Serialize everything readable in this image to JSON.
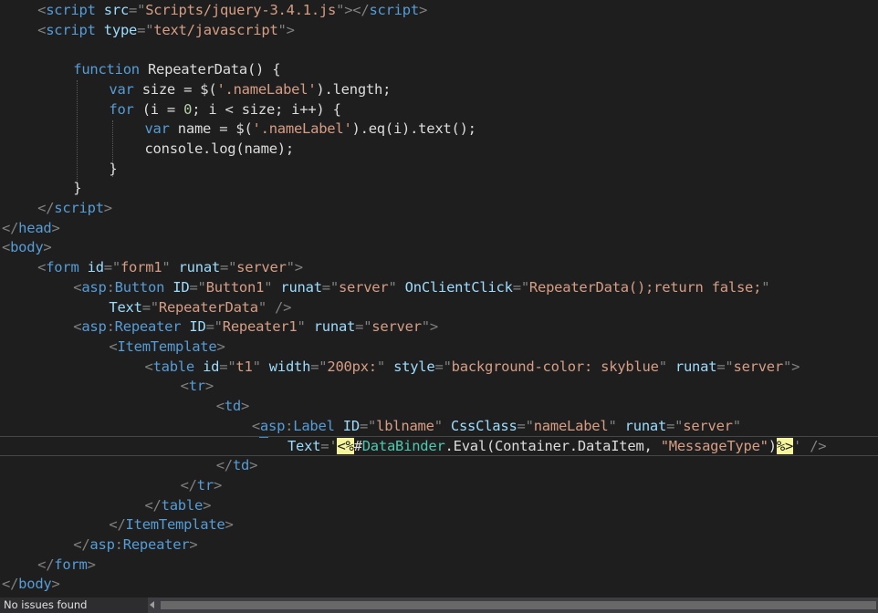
{
  "editor": {
    "lines": [
      {
        "indent": 4,
        "tokens": [
          [
            "p",
            "<"
          ],
          [
            "tag",
            "script"
          ],
          [
            "txt",
            " "
          ],
          [
            "attr",
            "src"
          ],
          [
            "p",
            "=\""
          ],
          [
            "str",
            "Scripts/jquery-3.4.1.js"
          ],
          [
            "p",
            "\"></"
          ],
          [
            "tag",
            "script"
          ],
          [
            "p",
            ">"
          ]
        ]
      },
      {
        "indent": 4,
        "tokens": [
          [
            "p",
            "<"
          ],
          [
            "tag",
            "script"
          ],
          [
            "txt",
            " "
          ],
          [
            "attr",
            "type"
          ],
          [
            "p",
            "=\""
          ],
          [
            "str",
            "text/javascript"
          ],
          [
            "p",
            "\">"
          ]
        ]
      },
      {
        "indent": 0,
        "tokens": []
      },
      {
        "indent": 8,
        "tokens": [
          [
            "kw",
            "function"
          ],
          [
            "txt",
            " RepeaterData() {"
          ]
        ]
      },
      {
        "indent": 12,
        "tokens": [
          [
            "kw",
            "var"
          ],
          [
            "txt",
            " size = $("
          ],
          [
            "js",
            "'.nameLabel'"
          ],
          [
            "txt",
            ").length;"
          ]
        ]
      },
      {
        "indent": 12,
        "tokens": [
          [
            "kw",
            "for"
          ],
          [
            "txt",
            " (i = "
          ],
          [
            "num",
            "0"
          ],
          [
            "txt",
            "; i < size; i++) {"
          ]
        ]
      },
      {
        "indent": 16,
        "tokens": [
          [
            "kw",
            "var"
          ],
          [
            "txt",
            " name = $("
          ],
          [
            "js",
            "'.nameLabel'"
          ],
          [
            "txt",
            ").eq(i).text();"
          ]
        ]
      },
      {
        "indent": 16,
        "tokens": [
          [
            "txt",
            "console.log(name);"
          ]
        ]
      },
      {
        "indent": 12,
        "tokens": [
          [
            "txt",
            "}"
          ]
        ]
      },
      {
        "indent": 8,
        "tokens": [
          [
            "txt",
            "}"
          ]
        ]
      },
      {
        "indent": 4,
        "tokens": [
          [
            "p",
            "</"
          ],
          [
            "tag",
            "script"
          ],
          [
            "p",
            ">"
          ]
        ]
      },
      {
        "indent": 0,
        "tokens": [
          [
            "p",
            "</"
          ],
          [
            "tag",
            "head"
          ],
          [
            "p",
            ">"
          ]
        ]
      },
      {
        "indent": 0,
        "tokens": [
          [
            "p",
            "<"
          ],
          [
            "tag",
            "body"
          ],
          [
            "p",
            ">"
          ]
        ]
      },
      {
        "indent": 4,
        "tokens": [
          [
            "p",
            "<"
          ],
          [
            "tag",
            "form"
          ],
          [
            "txt",
            " "
          ],
          [
            "attr",
            "id"
          ],
          [
            "p",
            "=\""
          ],
          [
            "str",
            "form1"
          ],
          [
            "p",
            "\""
          ],
          [
            "txt",
            " "
          ],
          [
            "attr",
            "runat"
          ],
          [
            "p",
            "=\""
          ],
          [
            "str",
            "server"
          ],
          [
            "p",
            "\">"
          ]
        ]
      },
      {
        "indent": 8,
        "tokens": [
          [
            "p",
            "<"
          ],
          [
            "tag",
            "asp"
          ],
          [
            "p",
            ":"
          ],
          [
            "tag",
            "Button"
          ],
          [
            "txt",
            " "
          ],
          [
            "attr",
            "ID"
          ],
          [
            "p",
            "=\""
          ],
          [
            "str",
            "Button1"
          ],
          [
            "p",
            "\""
          ],
          [
            "txt",
            " "
          ],
          [
            "attr",
            "runat"
          ],
          [
            "p",
            "=\""
          ],
          [
            "str",
            "server"
          ],
          [
            "p",
            "\""
          ],
          [
            "txt",
            " "
          ],
          [
            "attr",
            "OnClientClick"
          ],
          [
            "p",
            "=\""
          ],
          [
            "str",
            "RepeaterData();return false;"
          ],
          [
            "p",
            "\""
          ]
        ]
      },
      {
        "indent": 12,
        "tokens": [
          [
            "attr",
            "Text"
          ],
          [
            "p",
            "=\""
          ],
          [
            "str",
            "RepeaterData"
          ],
          [
            "p",
            "\""
          ],
          [
            "txt",
            " "
          ],
          [
            "p",
            "/>"
          ]
        ]
      },
      {
        "indent": 8,
        "tokens": [
          [
            "p",
            "<"
          ],
          [
            "tag",
            "asp"
          ],
          [
            "p",
            ":"
          ],
          [
            "tag",
            "Repeater"
          ],
          [
            "txt",
            " "
          ],
          [
            "attr",
            "ID"
          ],
          [
            "p",
            "=\""
          ],
          [
            "str",
            "Repeater1"
          ],
          [
            "p",
            "\""
          ],
          [
            "txt",
            " "
          ],
          [
            "attr",
            "runat"
          ],
          [
            "p",
            "=\""
          ],
          [
            "str",
            "server"
          ],
          [
            "p",
            "\">"
          ]
        ]
      },
      {
        "indent": 12,
        "tokens": [
          [
            "p",
            "<"
          ],
          [
            "tag",
            "ItemTemplate"
          ],
          [
            "p",
            ">"
          ]
        ]
      },
      {
        "indent": 16,
        "tokens": [
          [
            "p",
            "<"
          ],
          [
            "tag",
            "table"
          ],
          [
            "txt",
            " "
          ],
          [
            "attr",
            "id"
          ],
          [
            "p",
            "=\""
          ],
          [
            "str",
            "t1"
          ],
          [
            "p",
            "\""
          ],
          [
            "txt",
            " "
          ],
          [
            "attr",
            "width"
          ],
          [
            "p",
            "=\""
          ],
          [
            "str",
            "200px:"
          ],
          [
            "p",
            "\""
          ],
          [
            "txt",
            " "
          ],
          [
            "attr",
            "style"
          ],
          [
            "p",
            "=\""
          ],
          [
            "str",
            "background-color: skyblue"
          ],
          [
            "p",
            "\""
          ],
          [
            "txt",
            " "
          ],
          [
            "attr",
            "runat"
          ],
          [
            "p",
            "=\""
          ],
          [
            "str",
            "server"
          ],
          [
            "p",
            "\">"
          ]
        ]
      },
      {
        "indent": 20,
        "tokens": [
          [
            "p",
            "<"
          ],
          [
            "tag",
            "tr"
          ],
          [
            "p",
            ">"
          ]
        ]
      },
      {
        "indent": 24,
        "tokens": [
          [
            "p",
            "<"
          ],
          [
            "tag",
            "td"
          ],
          [
            "p",
            ">"
          ]
        ]
      },
      {
        "indent": 28,
        "tokens": [
          [
            "p",
            "<"
          ],
          [
            "tag",
            "asp"
          ],
          [
            "p",
            ":"
          ],
          [
            "tag",
            "Label"
          ],
          [
            "txt",
            " "
          ],
          [
            "attr",
            "ID"
          ],
          [
            "p",
            "=\""
          ],
          [
            "str",
            "lblname"
          ],
          [
            "p",
            "\""
          ],
          [
            "txt",
            " "
          ],
          [
            "attr",
            "CssClass"
          ],
          [
            "p",
            "=\""
          ],
          [
            "str",
            "nameLabel"
          ],
          [
            "p",
            "\""
          ],
          [
            "txt",
            " "
          ],
          [
            "attr",
            "runat"
          ],
          [
            "p",
            "=\""
          ],
          [
            "str",
            "server"
          ],
          [
            "p",
            "\""
          ]
        ]
      },
      {
        "indent": 32,
        "current": true,
        "tokens": [
          [
            "attr",
            "Text"
          ],
          [
            "p",
            "='"
          ],
          [
            "delim",
            "<%"
          ],
          [
            "asp",
            "#"
          ],
          [
            "cls",
            "DataBinder"
          ],
          [
            "asp",
            "."
          ],
          [
            "method",
            "Eval"
          ],
          [
            "asp",
            "(Container.DataItem, "
          ],
          [
            "str",
            "\"MessageType\""
          ],
          [
            "asp",
            ")"
          ],
          [
            "delim",
            "%>"
          ],
          [
            "p",
            "'"
          ],
          [
            "txt",
            " "
          ],
          [
            "p",
            "/>"
          ]
        ]
      },
      {
        "indent": 24,
        "tokens": [
          [
            "p",
            "</"
          ],
          [
            "tag",
            "td"
          ],
          [
            "p",
            ">"
          ]
        ]
      },
      {
        "indent": 20,
        "tokens": [
          [
            "p",
            "</"
          ],
          [
            "tag",
            "tr"
          ],
          [
            "p",
            ">"
          ]
        ]
      },
      {
        "indent": 16,
        "tokens": [
          [
            "p",
            "</"
          ],
          [
            "tag",
            "table"
          ],
          [
            "p",
            ">"
          ]
        ]
      },
      {
        "indent": 12,
        "tokens": [
          [
            "p",
            "</"
          ],
          [
            "tag",
            "ItemTemplate"
          ],
          [
            "p",
            ">"
          ]
        ]
      },
      {
        "indent": 8,
        "tokens": [
          [
            "p",
            "</"
          ],
          [
            "tag",
            "asp"
          ],
          [
            "p",
            ":"
          ],
          [
            "tag",
            "Repeater"
          ],
          [
            "p",
            ">"
          ]
        ]
      },
      {
        "indent": 4,
        "tokens": [
          [
            "p",
            "</"
          ],
          [
            "tag",
            "form"
          ],
          [
            "p",
            ">"
          ]
        ]
      },
      {
        "indent": 0,
        "tokens": [
          [
            "p",
            "</"
          ],
          [
            "tag",
            "body"
          ],
          [
            "p",
            ">"
          ]
        ]
      }
    ]
  },
  "status": {
    "issues_text": "No issues found",
    "scroll_left_icon": "chevron-left-icon"
  }
}
